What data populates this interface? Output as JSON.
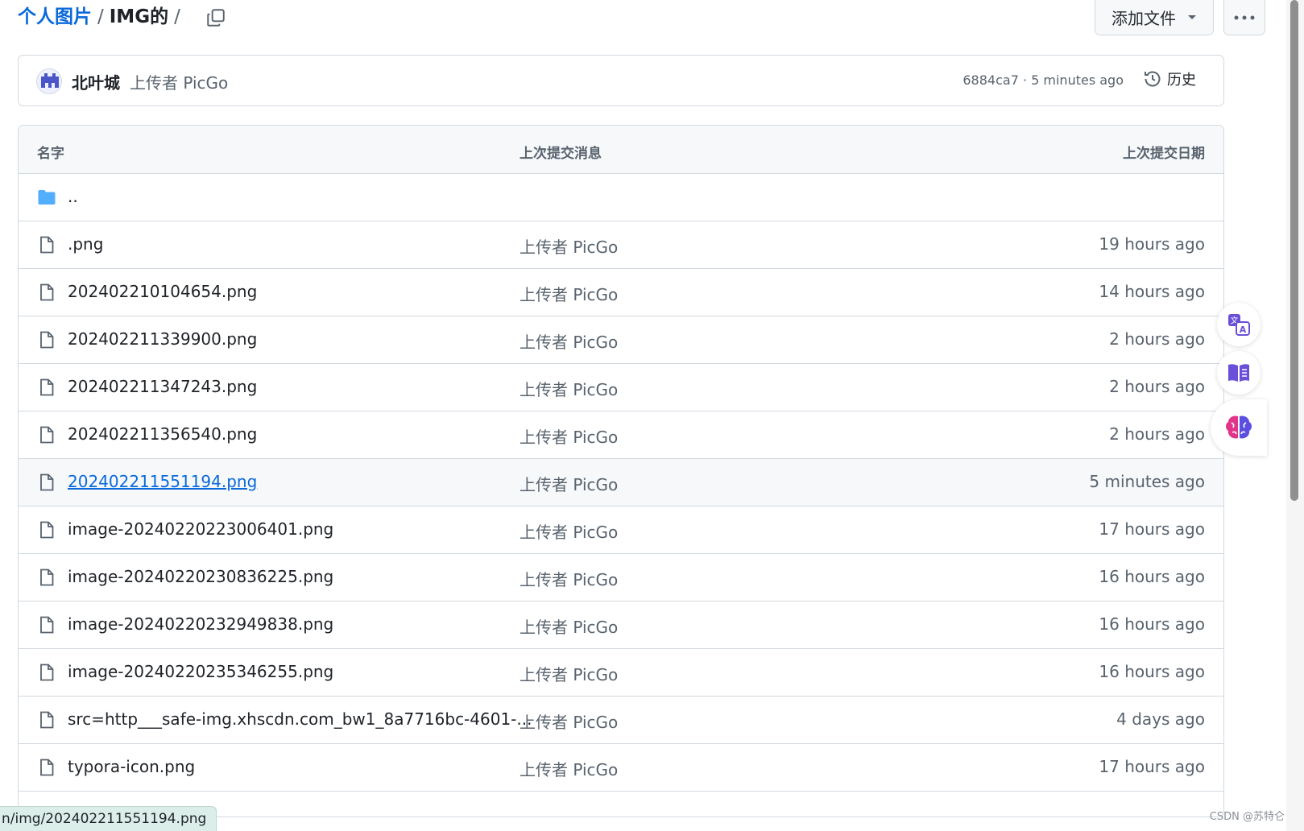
{
  "breadcrumb": {
    "root": "个人图片",
    "separator": "/",
    "current": "IMG的",
    "trailing_separator": "/"
  },
  "toolbar": {
    "add_file_label": "添加文件"
  },
  "commit": {
    "author": "北叶城",
    "message": "上传者 PicGo",
    "meta": "6884ca7 · 5 minutes ago",
    "history_label": "历史"
  },
  "table": {
    "headers": {
      "name": "名字",
      "message": "上次提交消息",
      "date": "上次提交日期"
    },
    "parent_dir": "..",
    "rows": [
      {
        "name": ".png",
        "message": "上传者 PicGo",
        "date": "19 hours ago"
      },
      {
        "name": "202402210104654.png",
        "message": "上传者 PicGo",
        "date": "14 hours ago"
      },
      {
        "name": "202402211339900.png",
        "message": "上传者 PicGo",
        "date": "2 hours ago"
      },
      {
        "name": "202402211347243.png",
        "message": "上传者 PicGo",
        "date": "2 hours ago"
      },
      {
        "name": "202402211356540.png",
        "message": "上传者 PicGo",
        "date": "2 hours ago"
      },
      {
        "name": "202402211551194.png",
        "message": "上传者 PicGo",
        "date": "5 minutes ago"
      },
      {
        "name": "image-20240220223006401.png",
        "message": "上传者 PicGo",
        "date": "17 hours ago"
      },
      {
        "name": "image-20240220230836225.png",
        "message": "上传者 PicGo",
        "date": "16 hours ago"
      },
      {
        "name": "image-20240220232949838.png",
        "message": "上传者 PicGo",
        "date": "16 hours ago"
      },
      {
        "name": "image-20240220235346255.png",
        "message": "上传者 PicGo",
        "date": "16 hours ago"
      },
      {
        "name": "src=http___safe-img.xhscdn.com_bw1_8a7716bc-4601-...",
        "message": "上传者 PicGo",
        "date": "4 days ago"
      },
      {
        "name": "typora-icon.png",
        "message": "上传者 PicGo",
        "date": "17 hours ago"
      }
    ]
  },
  "status_bar": {
    "url": "n/img/202402211551194.png"
  },
  "watermark": "CSDN @苏特仑",
  "icons": {
    "copy": "copy-icon",
    "caret": "caret-down-icon",
    "more": "kebab-horizontal-icon",
    "history": "history-clock-icon",
    "folder": "folder-icon",
    "file": "file-icon",
    "translate": "translate-icon",
    "reader": "book-icon",
    "ai": "brain-icon"
  },
  "colors": {
    "link": "#0969da",
    "muted": "#59636e",
    "border": "#d1d9e0",
    "header_bg": "#f6f8fa",
    "folder": "#54aeff",
    "status_bar_bg": "#dceee9"
  }
}
